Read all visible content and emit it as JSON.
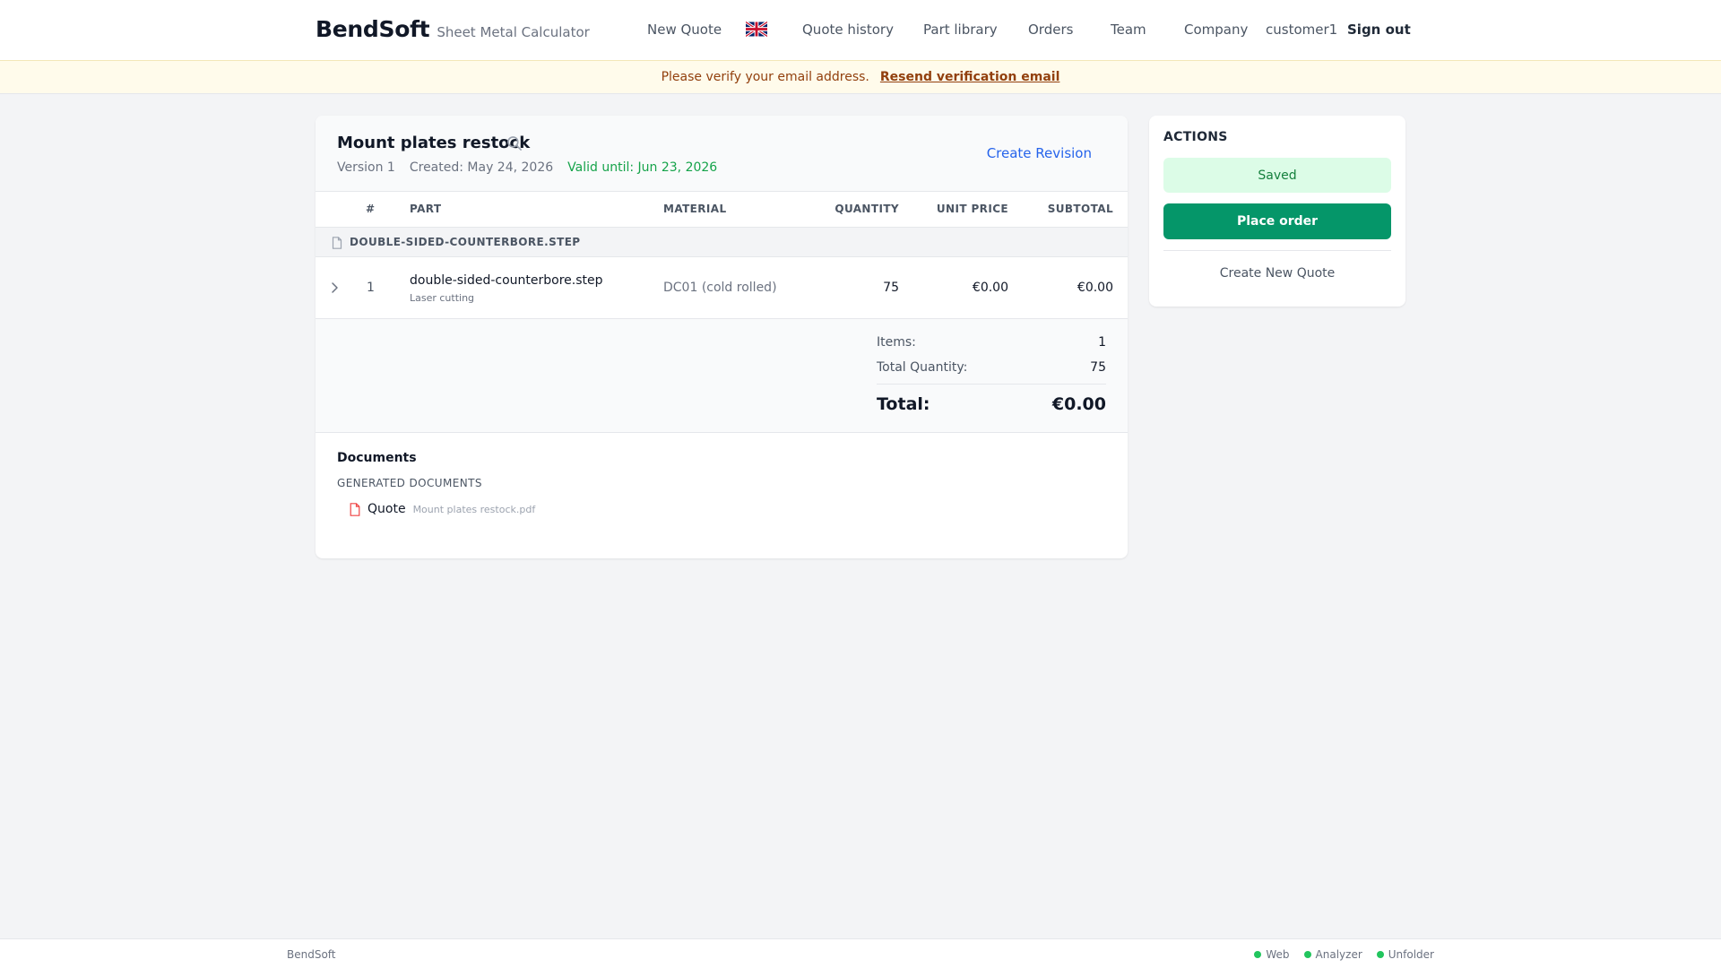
{
  "header": {
    "brand": "BendSoft",
    "subtitle": "Sheet Metal Calculator",
    "nav": {
      "new_quote": "New Quote",
      "quote_history": "Quote history",
      "part_library": "Part library",
      "orders": "Orders",
      "team": "Team",
      "company": "Company",
      "user": "customer1",
      "sign_out": "Sign out"
    },
    "language_icon": "uk-flag-icon"
  },
  "banner": {
    "message": "Please verify your email address.",
    "link": "Resend verification email"
  },
  "quote": {
    "title": "Mount plates restock",
    "version": "Version 1",
    "created": "Created: May 24, 2026",
    "valid_until": "Valid until: Jun 23, 2026",
    "create_revision": "Create Revision",
    "columns": {
      "index": "#",
      "part": "PART",
      "material": "MATERIAL",
      "quantity": "QUANTITY",
      "unit_price": "UNIT PRICE",
      "subtotal": "SUBTOTAL"
    },
    "group": "DOUBLE-SIDED-COUNTERBORE.STEP",
    "items": [
      {
        "index": "1",
        "name": "double-sided-counterbore.step",
        "process": "Laser cutting",
        "material": "DC01 (cold rolled)",
        "quantity": "75",
        "unit_price": "€0.00",
        "subtotal": "€0.00"
      }
    ],
    "summary": {
      "items_label": "Items:",
      "items_value": "1",
      "total_qty_label": "Total Quantity:",
      "total_qty_value": "75",
      "total_label": "Total:",
      "total_value": "€0.00"
    },
    "documents": {
      "title": "Documents",
      "subtitle": "GENERATED DOCUMENTS",
      "items": [
        {
          "label": "Quote",
          "file": "Mount plates restock.pdf"
        }
      ]
    }
  },
  "actions": {
    "title": "ACTIONS",
    "saved": "Saved",
    "place_order": "Place order",
    "create_new_quote": "Create New Quote"
  },
  "footer": {
    "brand": "BendSoft",
    "statuses": [
      "Web",
      "Analyzer",
      "Unfolder"
    ]
  },
  "colors": {
    "primary_button": "#059669",
    "link": "#2563eb",
    "valid": "#16a34a",
    "banner_bg": "#fffbeb",
    "status_ok": "#22c55e"
  }
}
